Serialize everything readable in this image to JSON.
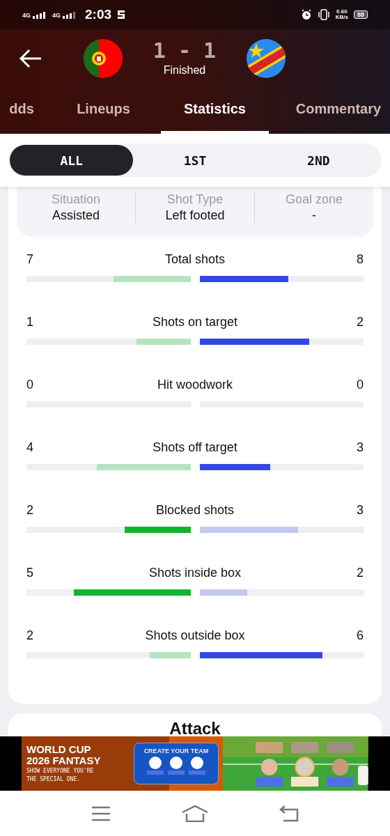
{
  "status_bar": {
    "network_1": "4G",
    "network_2": "4G",
    "time": "2:03",
    "speed_value": "0.60",
    "speed_unit": "KB/s",
    "battery": "88"
  },
  "match": {
    "score": "1 - 1",
    "status": "Finished"
  },
  "tabs": [
    {
      "label": "dds",
      "selected": false
    },
    {
      "label": "Lineups",
      "selected": false
    },
    {
      "label": "Statistics",
      "selected": true
    },
    {
      "label": "Commentary",
      "selected": false
    }
  ],
  "periods": [
    {
      "label": "ALL",
      "selected": true
    },
    {
      "label": "1ST",
      "selected": false
    },
    {
      "label": "2ND",
      "selected": false
    }
  ],
  "shot_details": [
    {
      "label": "Situation",
      "value": "Assisted"
    },
    {
      "label": "Shot Type",
      "value": "Left footed"
    },
    {
      "label": "Goal zone",
      "value": "-"
    }
  ],
  "stats": [
    {
      "name": "Total shots",
      "home": {
        "value": "7",
        "level": 0.47,
        "strong": false
      },
      "away": {
        "value": "8",
        "level": 0.54,
        "strong": true
      }
    },
    {
      "name": "Shots on target",
      "home": {
        "value": "1",
        "level": 0.33,
        "strong": false
      },
      "away": {
        "value": "2",
        "level": 0.67,
        "strong": true
      }
    },
    {
      "name": "Hit woodwork",
      "home": {
        "value": "0"
      },
      "away": {
        "value": "0"
      }
    },
    {
      "name": "Shots off target",
      "home": {
        "value": "4",
        "level": 0.57,
        "strong": false
      },
      "away": {
        "value": "3",
        "level": 0.43,
        "strong": true
      }
    },
    {
      "name": "Blocked shots",
      "home": {
        "value": "2",
        "level": 0.4,
        "strong": true
      },
      "away": {
        "value": "3",
        "level": 0.6,
        "strong": false
      }
    },
    {
      "name": "Shots inside box",
      "home": {
        "value": "5",
        "level": 0.71,
        "strong": true
      },
      "away": {
        "value": "2",
        "level": 0.29,
        "strong": false
      }
    },
    {
      "name": "Shots outside box",
      "home": {
        "value": "2",
        "level": 0.25,
        "strong": false
      },
      "away": {
        "value": "6",
        "level": 0.75,
        "strong": true
      }
    }
  ],
  "next_section": {
    "title": "Attack"
  },
  "ad": {
    "title_1": "WORLD CUP",
    "title_2": "2026 FANTASY",
    "tagline_1": "SHOW EVERYONE YOU'RE",
    "tagline_2": "THE SPECIAL ONE.",
    "button": "CREATE YOUR TEAM"
  }
}
